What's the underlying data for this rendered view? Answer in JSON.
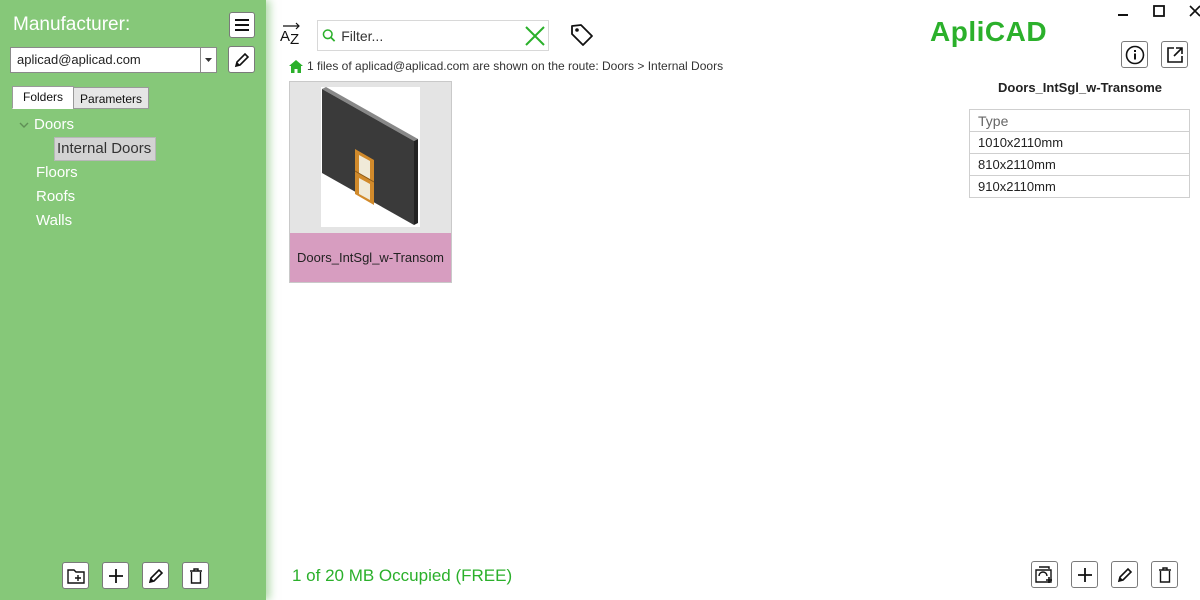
{
  "sidebar": {
    "title": "Manufacturer:",
    "manufacturer_value": "aplicad@aplicad.com",
    "tabs": [
      {
        "label": "Folders",
        "active": true
      },
      {
        "label": "Parameters",
        "active": false
      }
    ],
    "tree": {
      "doors": "Doors",
      "internal_doors": "Internal Doors",
      "floors": "Floors",
      "roofs": "Roofs",
      "walls": "Walls"
    }
  },
  "toolbar": {
    "filter_placeholder": "Filter...",
    "sort_icon": "sort-az-icon",
    "tag_icon": "tag-icon"
  },
  "header": {
    "logo": "ApliCAD"
  },
  "route": {
    "text": "1 files of aplicad@aplicad.com are shown on the route: Doors > Internal Doors"
  },
  "files": [
    {
      "name": "Doors_IntSgl_w-Transom"
    }
  ],
  "detail": {
    "title": "Doors_IntSgl_w-Transome",
    "column_header": "Type",
    "rows": [
      "1010x2110mm",
      "810x2110mm",
      "910x2110mm"
    ]
  },
  "footer": {
    "storage": "1 of 20 MB Occupied (FREE)"
  },
  "colors": {
    "sidebar": "#86c879",
    "accent_green": "#2bb02b",
    "card_label": "#d79dc0"
  }
}
